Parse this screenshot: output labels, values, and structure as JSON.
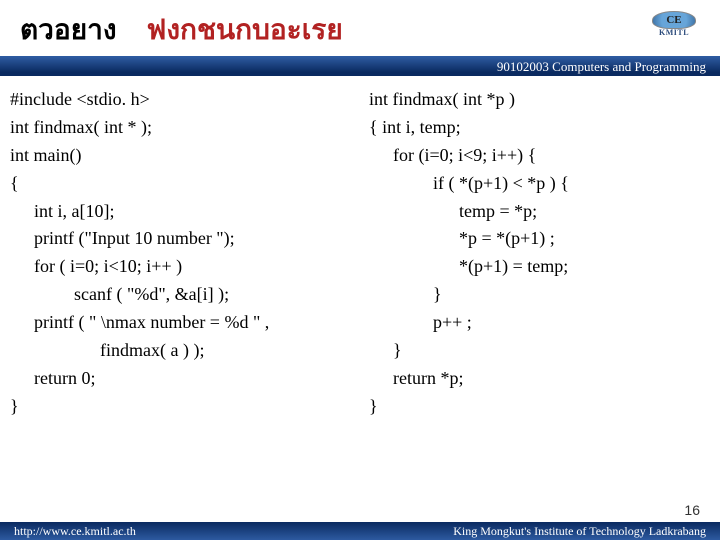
{
  "header": {
    "example_label": "ตวอยาง",
    "title": "ฟงกชนกบอะเรย"
  },
  "logo": {
    "top": "CE",
    "bottom": "KMITL"
  },
  "bluebar": {
    "course": "90102003 Computers and Programming"
  },
  "code_left": {
    "l1": "#include <stdio. h>",
    "l2": "int findmax( int * );",
    "l3": "int main()",
    "l4": "{",
    "l5": "int  i,  a[10];",
    "l6": "printf (\"Input 10 number \");",
    "l7": "for ( i=0;  i<10;  i++ )",
    "l8": "scanf ( \"%d\", &a[i] );",
    "l9": "printf ( \" \\nmax number = %d \" ,",
    "l10": "findmax( a ) );",
    "l11": "return 0;",
    "l12": "}"
  },
  "code_right": {
    "l1": "int findmax( int *p )",
    "l2": "{   int  i, temp;",
    "l3": "for (i=0; i<9; i++) {",
    "l4": "if ( *(p+1) < *p )  {",
    "l5": "temp   =  *p;",
    "l6": "*p       =  *(p+1) ;",
    "l7": "*(p+1) =  temp;",
    "l8": "}",
    "l9": "p++ ;",
    "l10": "}",
    "l11": "return *p;",
    "l12": "}"
  },
  "page": {
    "number": "16"
  },
  "footer": {
    "url": "http://www.ce.kmitl.ac.th",
    "inst": "King Mongkut's Institute of Technology Ladkrabang"
  }
}
